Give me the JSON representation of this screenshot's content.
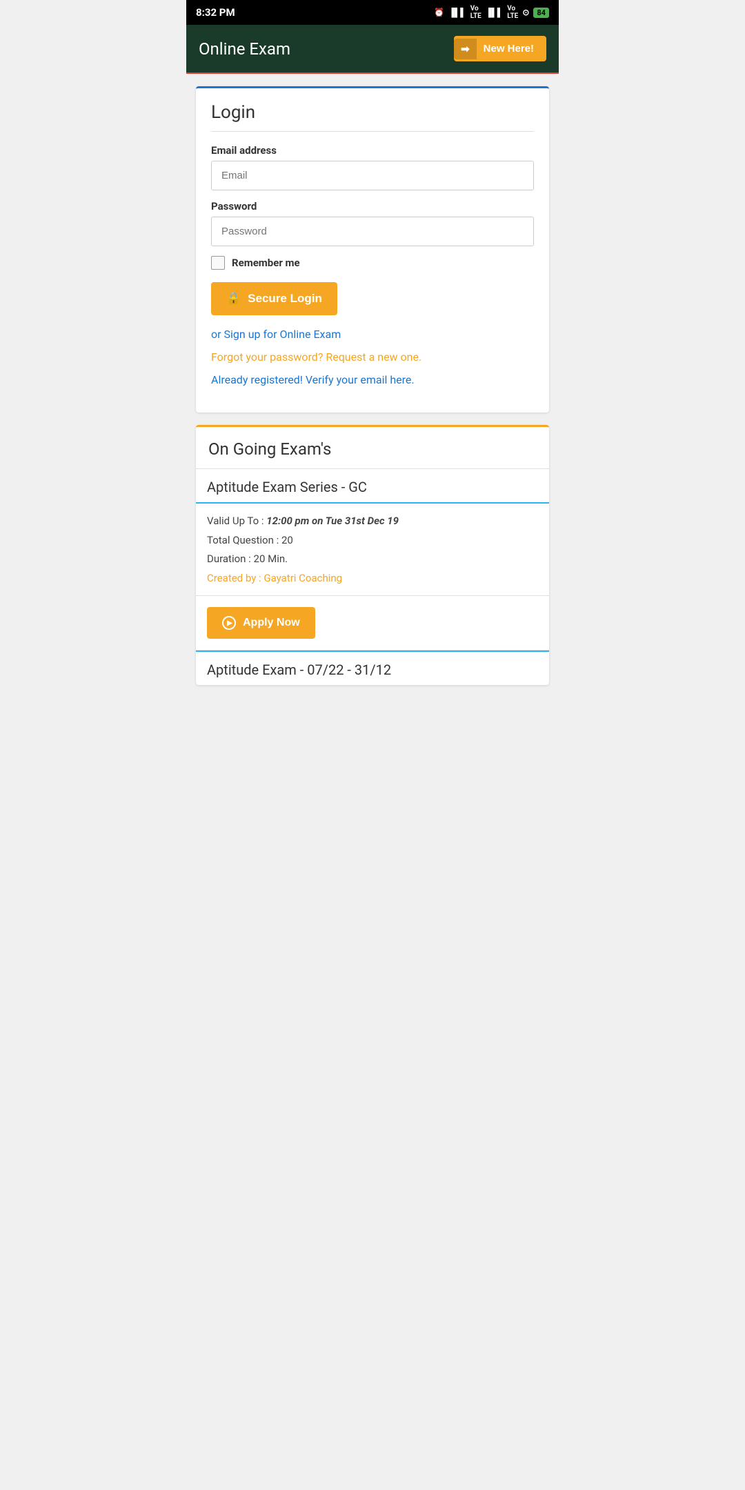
{
  "statusBar": {
    "time": "8:32 PM",
    "battery": "84"
  },
  "header": {
    "title": "Online Exam",
    "newHereButton": "New Here!"
  },
  "loginCard": {
    "title": "Login",
    "emailLabel": "Email address",
    "emailPlaceholder": "Email",
    "passwordLabel": "Password",
    "passwordPlaceholder": "Password",
    "rememberMe": "Remember me",
    "secureLoginBtn": "Secure Login",
    "signupLink": "or Sign up for Online Exam",
    "forgotLink": "Forgot your password? Request a new one.",
    "verifyLink": "Already registered! Verify your email here."
  },
  "ongoingSection": {
    "title": "On Going Exam's",
    "exams": [
      {
        "title": "Aptitude Exam Series - GC",
        "validUpto": "12:00 pm on Tue 31st Dec 19",
        "totalQuestion": "20",
        "duration": "20 Min.",
        "createdBy": "Gayatri Coaching",
        "applyBtn": "Apply Now"
      },
      {
        "title": "Aptitude Exam - 07/22 - 31/12"
      }
    ]
  }
}
